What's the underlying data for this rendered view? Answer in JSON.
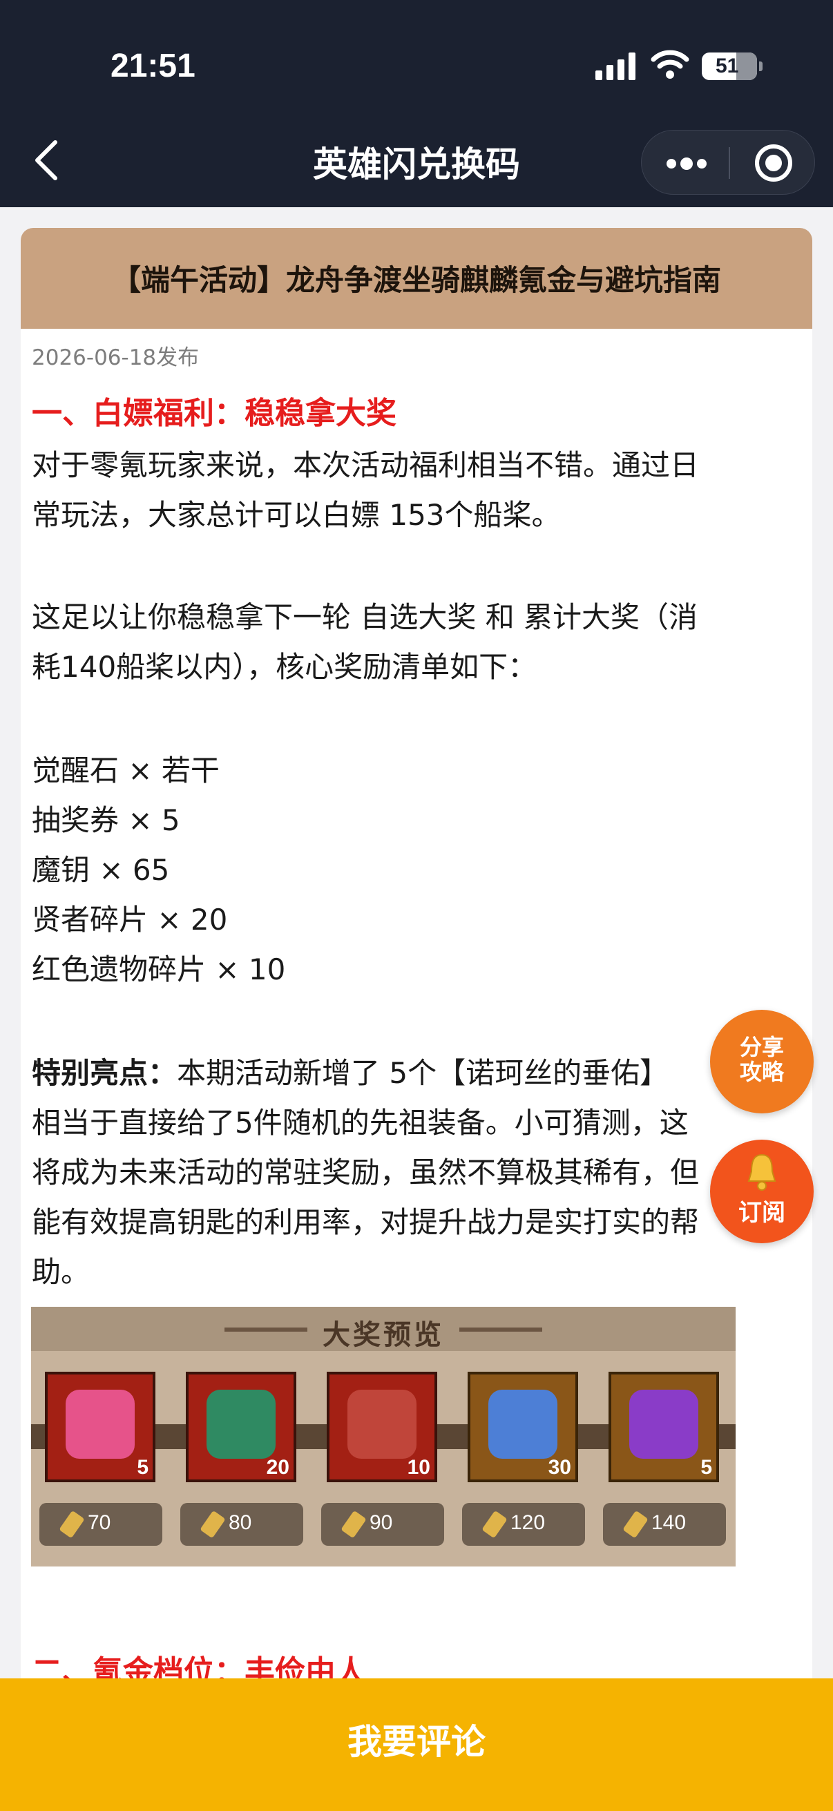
{
  "status_bar": {
    "time": "21:51",
    "battery": "51"
  },
  "nav": {
    "title": "英雄闪兑换码"
  },
  "article": {
    "title": "【端午活动】龙舟争渡坐骑麒麟氪金与避坑指南",
    "date": "2026-06-18发布",
    "section1_heading": "一、白嫖福利：稳稳拿大奖",
    "p1_line1": "对于零氪玩家来说，本次活动福利相当不错。通过日",
    "p1_line2": "常玩法，大家总计可以白嫖 153个船桨。",
    "p2_line1": "这足以让你稳稳拿下一轮 自选大奖 和 累计大奖（消",
    "p2_line2": "耗140船桨以内），核心奖励清单如下：",
    "rewards": [
      "觉醒石 × 若干",
      "抽奖券 × 5",
      "魔钥 × 65",
      "贤者碎片 × 20",
      "红色遗物碎片 × 10"
    ],
    "highlight_label": "特别亮点：",
    "highlight_line1": "本期活动新增了 5个【诺珂丝的垂佑】",
    "highlight_line2": "相当于直接给了5件随机的先祖装备。小可猜测，这",
    "highlight_line3": "将成为未来活动的常驻奖励，虽然不算极其稀有，但",
    "highlight_line4": "能有效提高钥匙的利用率，对提升战力是实打实的帮",
    "highlight_line5": "助。",
    "banner": {
      "title": "大奖预览",
      "prizes": [
        {
          "count": "5",
          "cost": "70"
        },
        {
          "count": "20",
          "cost": "80"
        },
        {
          "count": "10",
          "cost": "90"
        },
        {
          "count": "30",
          "cost": "120"
        },
        {
          "count": "5",
          "cost": "140"
        }
      ]
    },
    "section2_heading": "二、氪金档位：丰俭由人"
  },
  "fab": {
    "share_line1": "分享",
    "share_line2": "攻略",
    "subscribe": "订阅"
  },
  "bottom": {
    "comment_label": "我要评论"
  },
  "colors": {
    "header": "#1b2130",
    "title_band": "#c9a280",
    "heading_red": "#e61d1d",
    "comment_bar": "#f5b301",
    "fab_orange": "#f07a1f"
  }
}
